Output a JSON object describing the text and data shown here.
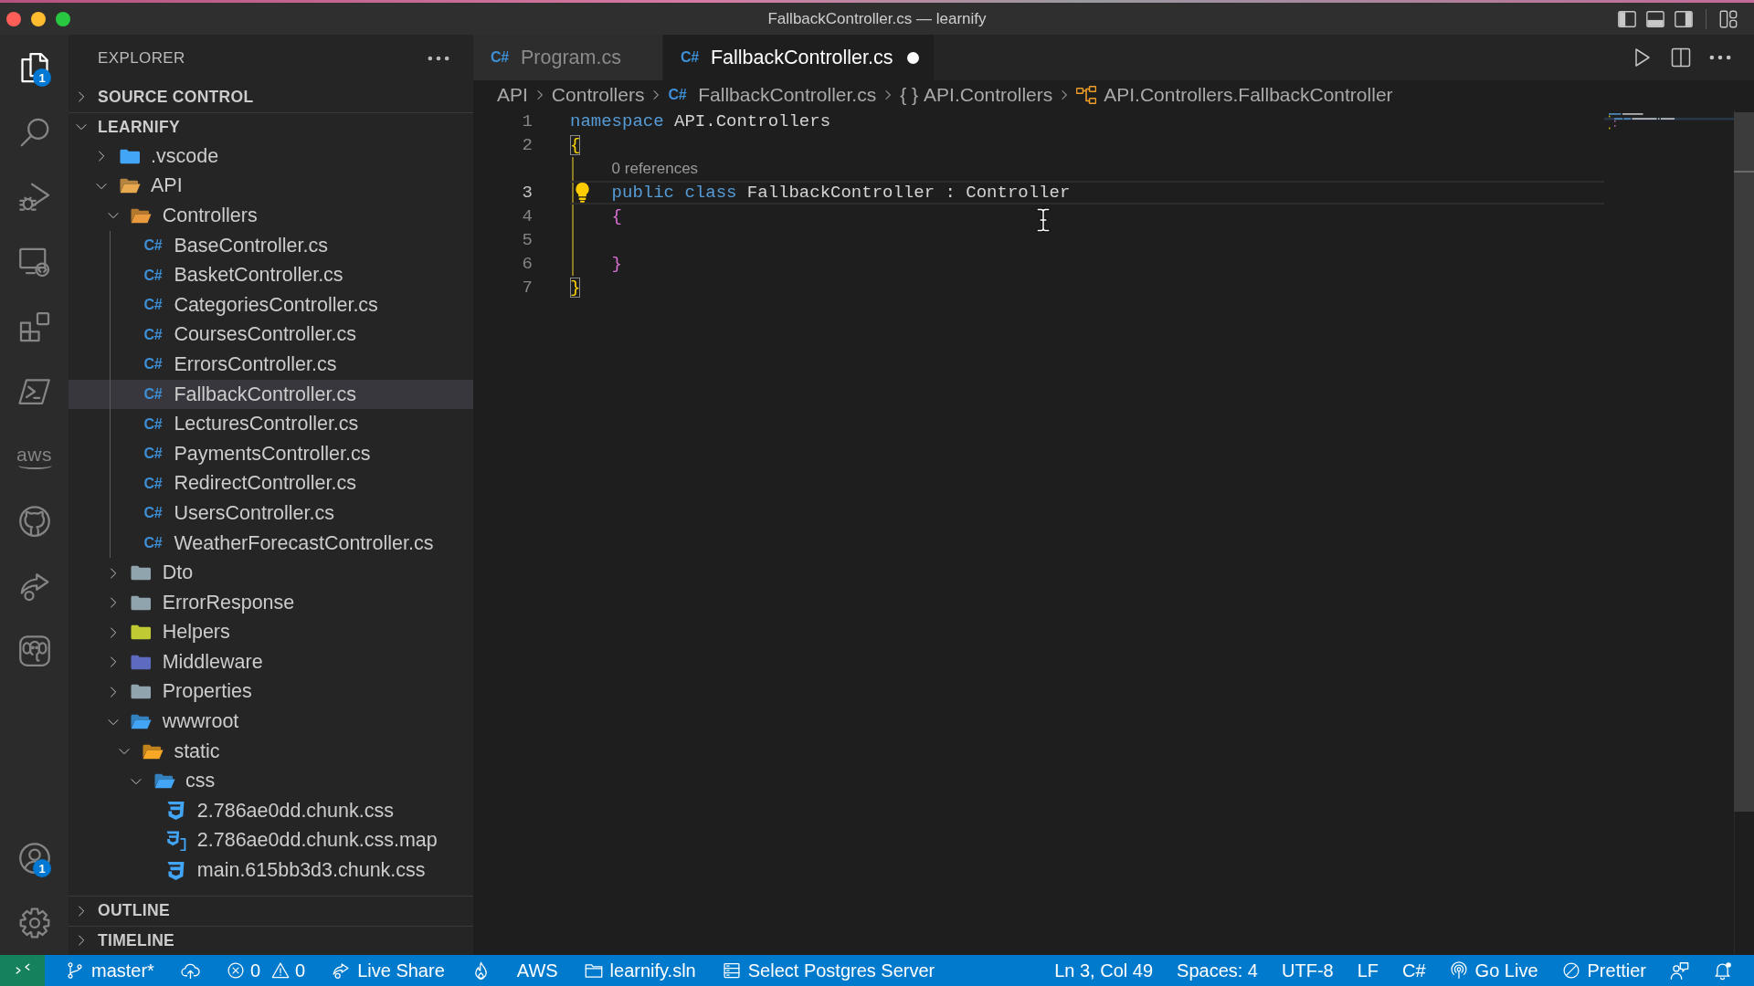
{
  "window": {
    "title": "FallbackController.cs — learnify"
  },
  "activity_bar": {
    "items": [
      {
        "kind": "explorer",
        "selected": true,
        "badge": "1"
      },
      {
        "kind": "search",
        "selected": false
      },
      {
        "kind": "debug",
        "selected": false
      },
      {
        "kind": "remote",
        "selected": false
      },
      {
        "kind": "extensions",
        "selected": false
      },
      {
        "kind": "terminal",
        "selected": false
      },
      {
        "kind": "aws",
        "label": "aws",
        "selected": false
      },
      {
        "kind": "github",
        "selected": false
      },
      {
        "kind": "liveshare",
        "selected": false
      },
      {
        "kind": "database",
        "selected": false
      }
    ],
    "bottom_items": [
      {
        "kind": "accounts",
        "badge": "1"
      },
      {
        "kind": "settings"
      }
    ]
  },
  "sidebar": {
    "title": "EXPLORER",
    "sections": [
      {
        "title": "SOURCE CONTROL",
        "expanded": false
      },
      {
        "title": "LEARNIFY",
        "expanded": true,
        "tree": [
          {
            "label": ".vscode",
            "kind": "folder",
            "color": "#42a5f5",
            "expanded": false,
            "selected": false
          },
          {
            "label": "API",
            "kind": "folder",
            "color": "#e8a94f",
            "expanded": true,
            "selected": false,
            "children": [
              {
                "label": "Controllers",
                "kind": "folder",
                "color": "#e89a3c",
                "expanded": true,
                "selected": false,
                "children": [
                  {
                    "label": "BaseController.cs",
                    "kind": "csharp",
                    "icon_label": "C#",
                    "selected": false
                  },
                  {
                    "label": "BasketController.cs",
                    "kind": "csharp",
                    "icon_label": "C#",
                    "selected": false
                  },
                  {
                    "label": "CategoriesController.cs",
                    "kind": "csharp",
                    "icon_label": "C#",
                    "selected": false
                  },
                  {
                    "label": "CoursesController.cs",
                    "kind": "csharp",
                    "icon_label": "C#",
                    "selected": false
                  },
                  {
                    "label": "ErrorsController.cs",
                    "kind": "csharp",
                    "icon_label": "C#",
                    "selected": false
                  },
                  {
                    "label": "FallbackController.cs",
                    "kind": "csharp",
                    "icon_label": "C#",
                    "selected": true
                  },
                  {
                    "label": "LecturesController.cs",
                    "kind": "csharp",
                    "icon_label": "C#",
                    "selected": false
                  },
                  {
                    "label": "PaymentsController.cs",
                    "kind": "csharp",
                    "icon_label": "C#",
                    "selected": false
                  },
                  {
                    "label": "RedirectController.cs",
                    "kind": "csharp",
                    "icon_label": "C#",
                    "selected": false
                  },
                  {
                    "label": "UsersController.cs",
                    "kind": "csharp",
                    "icon_label": "C#",
                    "selected": false
                  },
                  {
                    "label": "WeatherForecastController.cs",
                    "kind": "csharp",
                    "icon_label": "C#",
                    "selected": false
                  }
                ]
              },
              {
                "label": "Dto",
                "kind": "folder",
                "color": "#90a4ae",
                "expanded": false,
                "selected": false
              },
              {
                "label": "ErrorResponse",
                "kind": "folder",
                "color": "#90a4ae",
                "expanded": false,
                "selected": false
              },
              {
                "label": "Helpers",
                "kind": "folder",
                "color": "#c0ca33",
                "expanded": false,
                "selected": false
              },
              {
                "label": "Middleware",
                "kind": "folder",
                "color": "#5c6bc0",
                "expanded": false,
                "selected": false
              },
              {
                "label": "Properties",
                "kind": "folder",
                "color": "#90a4ae",
                "expanded": false,
                "selected": false
              },
              {
                "label": "wwwroot",
                "kind": "folder",
                "color": "#42a5f5",
                "expanded": true,
                "selected": false,
                "children": [
                  {
                    "label": "static",
                    "kind": "folder",
                    "color": "#f9a825",
                    "expanded": true,
                    "selected": false,
                    "children": [
                      {
                        "label": "css",
                        "kind": "folder",
                        "color": "#42a5f5",
                        "expanded": true,
                        "selected": false,
                        "children": [
                          {
                            "label": "2.786ae0dd.chunk.css",
                            "kind": "css",
                            "selected": false
                          },
                          {
                            "label": "2.786ae0dd.chunk.css.map",
                            "kind": "map",
                            "selected": false
                          },
                          {
                            "label": "main.615bb3d3.chunk.css",
                            "kind": "css",
                            "selected": false
                          }
                        ]
                      }
                    ]
                  }
                ]
              }
            ]
          }
        ]
      },
      {
        "title": "OUTLINE",
        "expanded": false
      },
      {
        "title": "TIMELINE",
        "expanded": false
      }
    ]
  },
  "editor": {
    "tabs": [
      {
        "label": "Program.cs",
        "icon_label": "C#",
        "selected": false,
        "modified": false
      },
      {
        "label": "FallbackController.cs",
        "icon_label": "C#",
        "selected": true,
        "modified": true
      }
    ],
    "breadcrumbs": [
      {
        "kind": "folder",
        "label": "API"
      },
      {
        "kind": "folder",
        "label": "Controllers"
      },
      {
        "kind": "file",
        "icon_label": "C#",
        "label": "FallbackController.cs"
      },
      {
        "kind": "namespace",
        "icon_label": "{ }",
        "label": "API.Controllers"
      },
      {
        "kind": "class",
        "label": "API.Controllers.FallbackController"
      }
    ],
    "lines": [
      {
        "number": "1",
        "current": false,
        "lightbulb": false,
        "tokens": [
          {
            "text": "namespace",
            "kind": "keyword"
          },
          {
            "text": " API.Controllers",
            "kind": "text"
          }
        ]
      },
      {
        "number": "2",
        "current": false,
        "lightbulb": false,
        "tokens": [
          {
            "text": "{",
            "kind": "brace",
            "color": "#ffd700",
            "matched": true
          }
        ]
      },
      {
        "number": "3",
        "current": true,
        "lightbulb": true,
        "codelens": "0 references",
        "tokens": [
          {
            "text": "    public class",
            "kind": "keyword"
          },
          {
            "text": " FallbackController : Controller",
            "kind": "text"
          }
        ]
      },
      {
        "number": "4",
        "current": false,
        "lightbulb": false,
        "tokens": [
          {
            "text": "    {",
            "kind": "brace",
            "color": "#da70d6",
            "matched": false
          }
        ]
      },
      {
        "number": "5",
        "current": false,
        "lightbulb": false
      },
      {
        "number": "6",
        "current": false,
        "lightbulb": false,
        "tokens": [
          {
            "text": "    }",
            "kind": "brace",
            "color": "#da70d6",
            "matched": false
          }
        ]
      },
      {
        "number": "7",
        "current": false,
        "lightbulb": false,
        "tokens": [
          {
            "text": "}",
            "kind": "brace",
            "color": "#ffd700",
            "matched": true
          }
        ]
      }
    ]
  },
  "status_bar": {
    "left": [
      {
        "kind": "remote"
      },
      {
        "kind": "branch",
        "label": "master*"
      },
      {
        "kind": "sync"
      },
      {
        "kind": "problems",
        "errors": "0",
        "warnings": "0"
      },
      {
        "kind": "liveshare",
        "label": "Live Share"
      },
      {
        "kind": "flame"
      },
      {
        "kind": "text",
        "label": "AWS"
      },
      {
        "kind": "solution",
        "label": "learnify.sln"
      },
      {
        "kind": "database",
        "label": "Select Postgres Server"
      }
    ],
    "right": [
      {
        "kind": "text",
        "label": "Ln 3, Col 49"
      },
      {
        "kind": "text",
        "label": "Spaces: 4"
      },
      {
        "kind": "text",
        "label": "UTF-8"
      },
      {
        "kind": "text",
        "label": "LF"
      },
      {
        "kind": "text",
        "label": "C#"
      },
      {
        "kind": "golive",
        "label": "Go Live"
      },
      {
        "kind": "prettier",
        "label": "Prettier"
      },
      {
        "kind": "feedback"
      },
      {
        "kind": "bell"
      }
    ]
  }
}
